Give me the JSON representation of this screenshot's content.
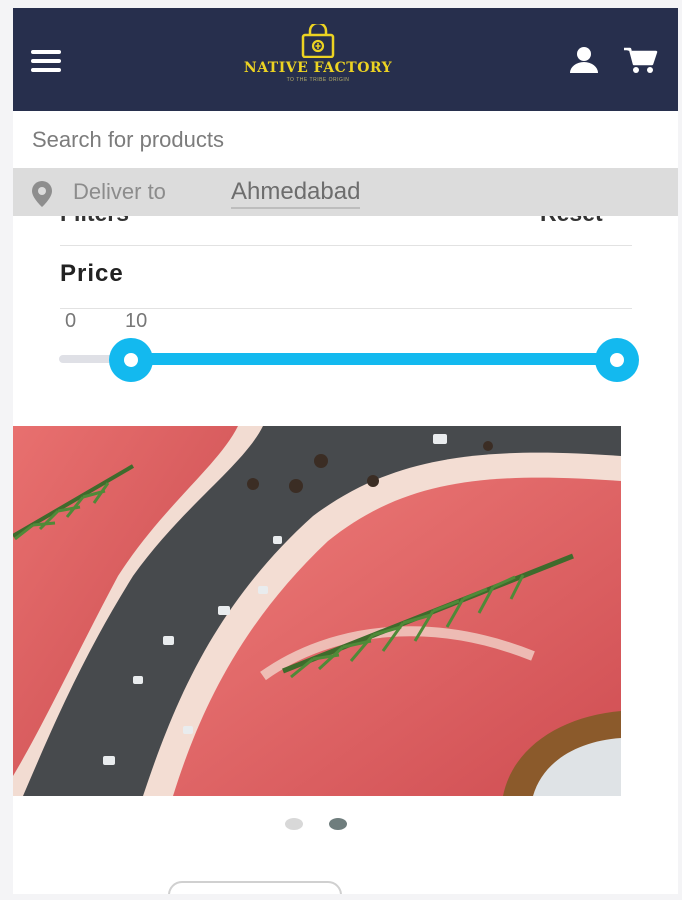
{
  "header": {
    "brand_name": "NATIVE FACTORY",
    "brand_tagline": "TO THE TRIBE ORIGIN",
    "icons": [
      "menu-icon",
      "shopping-bag-icon",
      "user-icon",
      "cart-icon"
    ],
    "colors": {
      "header_bg": "#272f4d",
      "brand": "#ecd322"
    }
  },
  "search": {
    "placeholder": "Search for products",
    "value": ""
  },
  "deliver": {
    "label": "Deliver to",
    "city": "Ahmedabad",
    "icon": "map-pin-icon"
  },
  "filters": {
    "title": "Filters",
    "reset_label": "Reset",
    "price": {
      "title": "Price",
      "min_label": "0",
      "max_label": "10",
      "range_low_fraction": 0.0,
      "range_high_fraction": 1.0,
      "accent": "#13b9ef"
    }
  },
  "carousel": {
    "slide_count": 2,
    "active_index": 1,
    "slide_subject": "raw steak with rosemary and salt"
  }
}
